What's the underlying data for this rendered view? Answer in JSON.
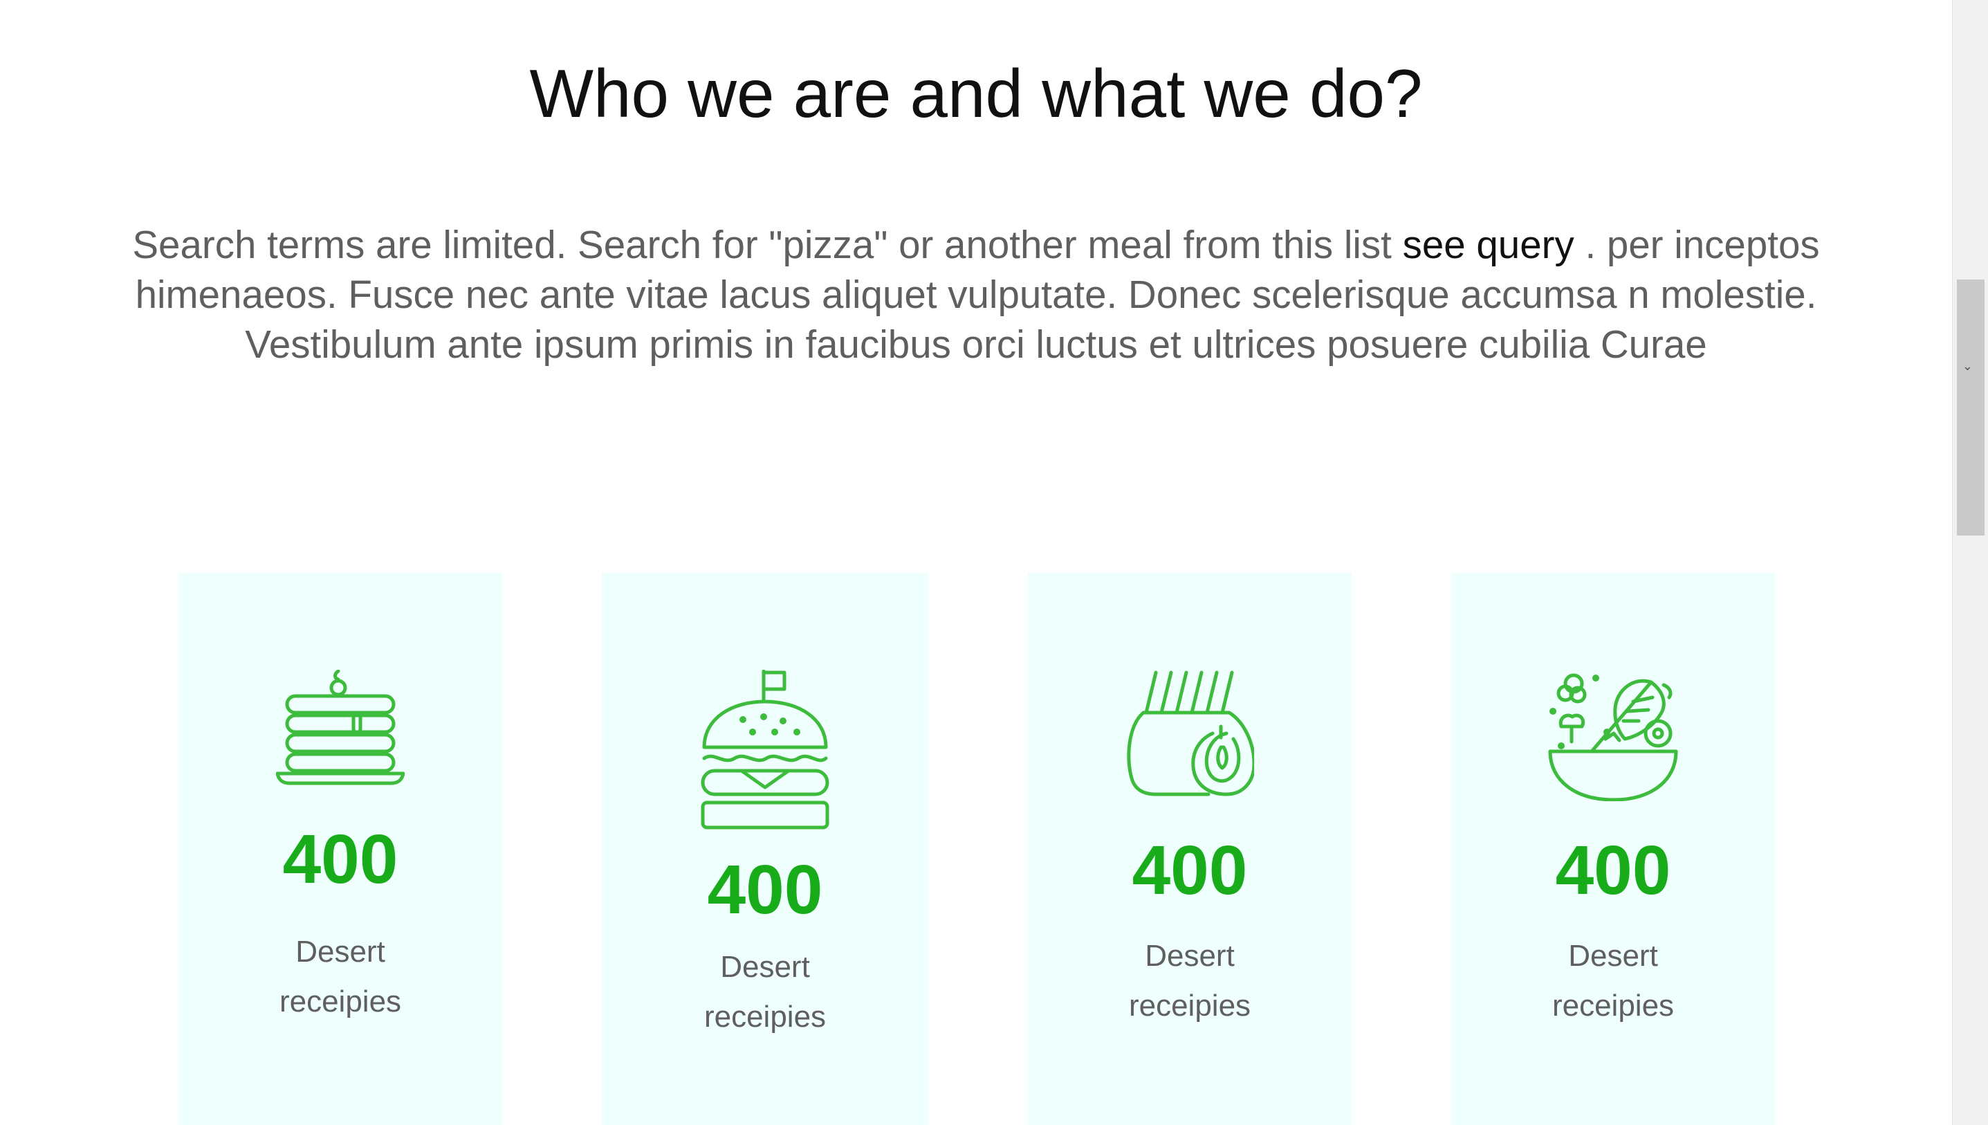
{
  "section": {
    "title": "Who we are and what we do?",
    "intro": {
      "line1_before_link": "Search terms are limited. Search for \"pizza\" or another meal from this list",
      "link_text": "see query",
      "line1_after_link": ". per inceptos",
      "line2": "himenaeos. Fusce nec ante vitae lacus aliquet vulputate. Donec scelerisque accumsa n molestie.",
      "line3": "Vestibulum ante ipsum primis in faucibus orci luctus et ultrices posuere cubilia Curae"
    }
  },
  "colors": {
    "accent_green": "#18ab1a",
    "icon_green": "#3dbb3c",
    "card_background": "#effffd",
    "body_text": "#5f5f5f",
    "heading_text": "#111111"
  },
  "cards": [
    {
      "icon": "pancakes-icon",
      "number": "400",
      "label_line1": "Desert",
      "label_line2": "receipies"
    },
    {
      "icon": "burger-icon",
      "number": "400",
      "label_line1": "Desert",
      "label_line2": "receipies"
    },
    {
      "icon": "ribs-icon",
      "number": "400",
      "label_line1": "Desert",
      "label_line2": "receipies"
    },
    {
      "icon": "salad-bowl-icon",
      "number": "400",
      "label_line1": "Desert",
      "label_line2": "receipies"
    }
  ]
}
